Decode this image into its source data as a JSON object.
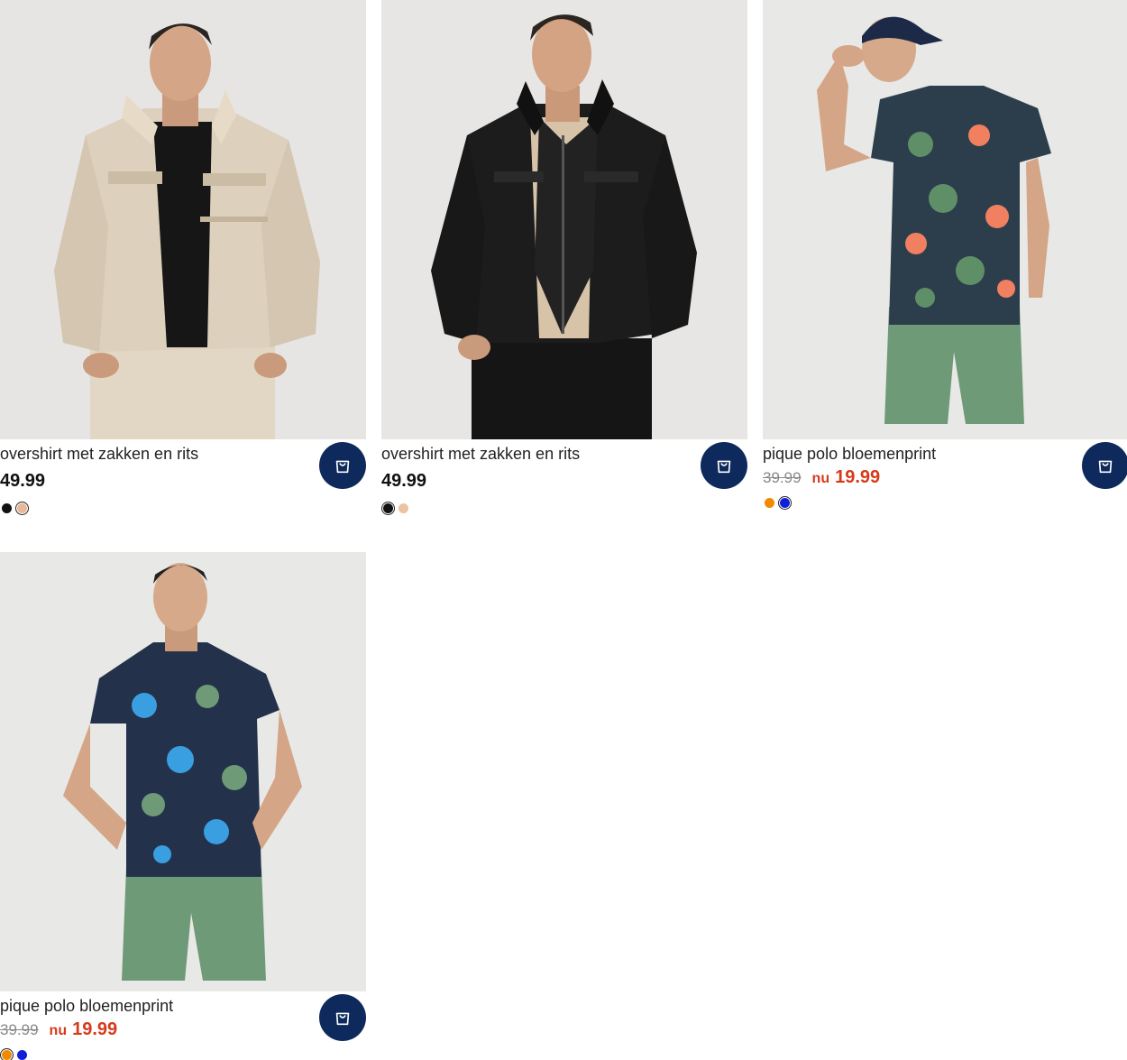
{
  "products": [
    {
      "title": "overshirt met zakken en rits",
      "price": "49.99",
      "swatches": [
        {
          "color": "#111111",
          "selected": false
        },
        {
          "color": "#e8b898",
          "selected": true
        }
      ]
    },
    {
      "title": "overshirt met zakken en rits",
      "price": "49.99",
      "swatches": [
        {
          "color": "#111111",
          "selected": true
        },
        {
          "color": "#e8c4a0",
          "selected": false
        }
      ]
    },
    {
      "title": "pique polo bloemenprint",
      "old_price": "39.99",
      "now_label": "nu",
      "new_price": "19.99",
      "swatches": [
        {
          "color": "#f08a00",
          "selected": false
        },
        {
          "color": "#1020d8",
          "selected": true
        }
      ]
    },
    {
      "title": "pique polo bloemenprint",
      "old_price": "39.99",
      "now_label": "nu",
      "new_price": "19.99",
      "swatches": [
        {
          "color": "#f08a00",
          "selected": true
        },
        {
          "color": "#1020d8",
          "selected": false
        }
      ]
    }
  ],
  "icons": {
    "cart": "shopping-bag-icon"
  },
  "colors": {
    "accent": "#0e2a5c",
    "sale": "#d63a1a"
  }
}
